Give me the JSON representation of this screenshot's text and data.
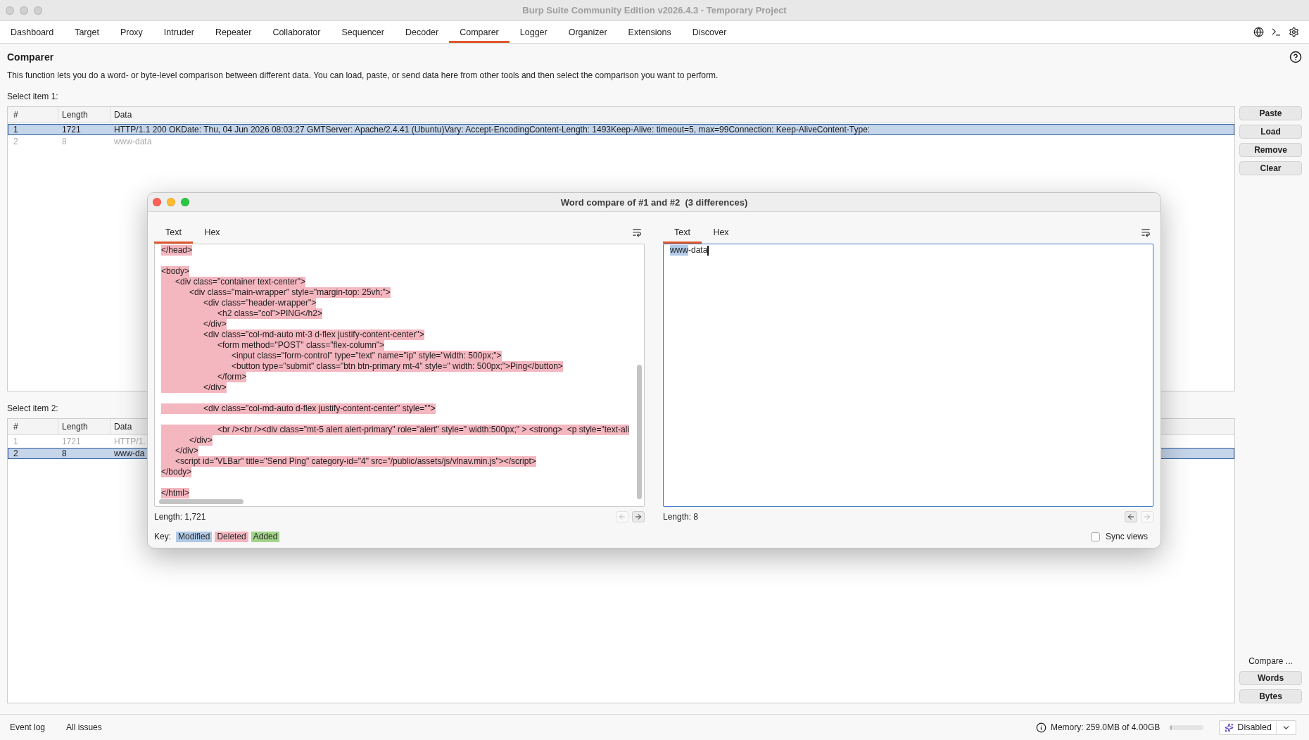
{
  "window": {
    "title": "Burp Suite Community Edition v2026.4.3 - Temporary Project",
    "active": false
  },
  "tabs": [
    {
      "label": "Dashboard",
      "selected": false
    },
    {
      "label": "Target",
      "selected": false
    },
    {
      "label": "Proxy",
      "selected": false
    },
    {
      "label": "Intruder",
      "selected": false
    },
    {
      "label": "Repeater",
      "selected": false
    },
    {
      "label": "Collaborator",
      "selected": false
    },
    {
      "label": "Sequencer",
      "selected": false
    },
    {
      "label": "Decoder",
      "selected": false
    },
    {
      "label": "Comparer",
      "selected": true
    },
    {
      "label": "Logger",
      "selected": false
    },
    {
      "label": "Organizer",
      "selected": false
    },
    {
      "label": "Extensions",
      "selected": false
    },
    {
      "label": "Discover",
      "selected": false
    }
  ],
  "page": {
    "title": "Comparer",
    "description": "This function lets you do a word- or byte-level comparison between different data. You can load, paste, or send data here from other tools and then select the comparison you want to perform."
  },
  "item_1": {
    "label": "Select item 1:",
    "columns": [
      "#",
      "Length",
      "Data"
    ],
    "rows": [
      {
        "cells": [
          "1",
          "1721",
          "HTTP/1.1 200 OKDate: Thu, 04 Jun 2026 08:03:27 GMTServer: Apache/2.4.41 (Ubuntu)Vary: Accept-EncodingContent-Length: 1493Keep-Alive: timeout=5, max=99Connection: Keep-AliveContent-Type:"
        ],
        "selected": true,
        "disabled": false
      },
      {
        "cells": [
          "2",
          "8",
          "www-data"
        ],
        "selected": false,
        "disabled": true
      }
    ],
    "buttons": [
      "Paste",
      "Load",
      "Remove",
      "Clear"
    ]
  },
  "item_2": {
    "label": "Select item 2:",
    "columns": [
      "#",
      "Length",
      "Data"
    ],
    "rows": [
      {
        "cells": [
          "1",
          "1721",
          "HTTP/1."
        ],
        "selected": false,
        "disabled": true
      },
      {
        "cells": [
          "2",
          "8",
          "www-da"
        ],
        "selected": true,
        "disabled": false
      }
    ],
    "compare_label": "Compare ...",
    "buttons": [
      "Words",
      "Bytes"
    ]
  },
  "dialog": {
    "title": "Word compare of #1 and #2  (3 differences)",
    "active": true,
    "panes": [
      {
        "tabs": [
          {
            "label": "Text",
            "selected": true
          },
          {
            "label": "Hex",
            "selected": false
          }
        ],
        "focused": false,
        "lines": [
          {
            "kind": "deleted",
            "text": "</head>"
          },
          {
            "kind": "blank"
          },
          {
            "kind": "deleted",
            "text": "<body>"
          },
          {
            "kind": "deleted",
            "text": "\t<div class=\"container text-center\">"
          },
          {
            "kind": "deleted",
            "text": "\t\t<div class=\"main-wrapper\" style=\"margin-top: 25vh;\">"
          },
          {
            "kind": "deleted",
            "text": "\t\t\t<div class=\"header-wrapper\">"
          },
          {
            "kind": "deleted",
            "text": "\t\t\t\t<h2 class=\"col\">PING</h2>"
          },
          {
            "kind": "deleted",
            "text": "\t\t\t</div>"
          },
          {
            "kind": "deleted",
            "text": "\t\t\t<div class=\"col-md-auto mt-3 d-flex justify-content-center\">"
          },
          {
            "kind": "deleted",
            "text": "\t\t\t\t<form method=\"POST\" class=\"flex-column\">"
          },
          {
            "kind": "deleted",
            "text": "\t\t\t\t\t<input class=\"form-control\" type=\"text\" name=\"ip\" style=\"width: 500px;\">"
          },
          {
            "kind": "deleted",
            "text": "\t\t\t\t\t<button type=\"submit\" class=\"btn btn-primary mt-4\" style=\" width: 500px;\">Ping</button>"
          },
          {
            "kind": "deleted",
            "text": "\t\t\t\t</form>"
          },
          {
            "kind": "deleted",
            "text": "\t\t\t</div>"
          },
          {
            "kind": "blank"
          },
          {
            "kind": "deleted",
            "text": "\t\t\t<div class=\"col-md-auto d-flex justify-content-center\" style=\"\">"
          },
          {
            "kind": "blank"
          },
          {
            "kind": "deleted",
            "text": "\t\t\t\t<br /><br /><div class=\"mt-5 alert alert-primary\" role=\"alert\" style=\" width:500px;\" > <strong>  <p style=\"text-ali"
          },
          {
            "kind": "deleted",
            "text": "\t\t</div>"
          },
          {
            "kind": "deleted",
            "text": "\t</div>"
          },
          {
            "kind": "deleted",
            "text": "\t<script id=\"VLBar\" title=\"Send Ping\" category-id=\"4\" src=\"/public/assets/js/vlnav.min.js\"></script>"
          },
          {
            "kind": "deleted",
            "text": "</body>"
          },
          {
            "kind": "blank"
          },
          {
            "kind": "deleted",
            "text": "</html>"
          }
        ],
        "length": "Length: 1,721",
        "prev_disabled": true,
        "next_disabled": false
      },
      {
        "tabs": [
          {
            "label": "Text",
            "selected": true
          },
          {
            "label": "Hex",
            "selected": false
          }
        ],
        "focused": true,
        "lines": [
          {
            "kind": "mixed",
            "segments": [
              {
                "kind": "modified",
                "text": "www"
              },
              {
                "kind": "plain",
                "text": "-data"
              }
            ]
          }
        ],
        "length": "Length: 8",
        "prev_disabled": false,
        "next_disabled": true
      }
    ],
    "key": {
      "label": "Key:",
      "items": [
        {
          "label": "Modified",
          "kind": "modified"
        },
        {
          "label": "Deleted",
          "kind": "deleted"
        },
        {
          "label": "Added",
          "kind": "added"
        }
      ]
    },
    "sync_views": {
      "label": "Sync views",
      "checked": false
    }
  },
  "status_bar": {
    "links": [
      "Event log",
      "All issues"
    ],
    "memory": {
      "text": "Memory: 259.0MB of 4.00GB",
      "level": 0.06
    },
    "ai_button": {
      "label": "Disabled"
    }
  }
}
